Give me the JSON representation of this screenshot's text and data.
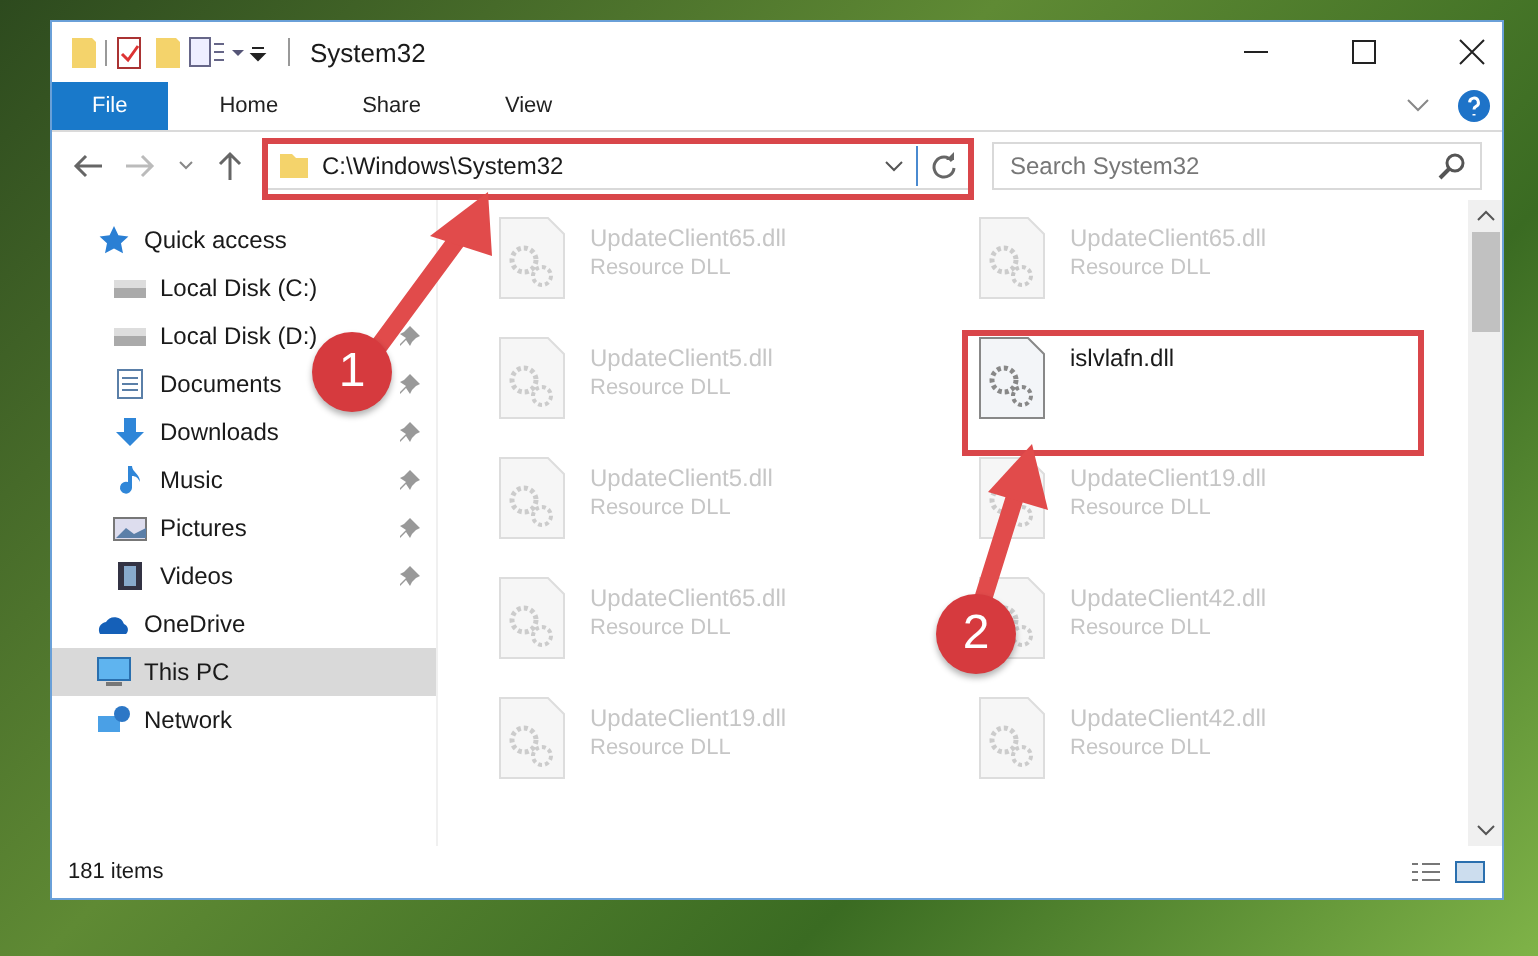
{
  "window": {
    "title": "System32"
  },
  "ribbon_tabs": [
    {
      "label": "File",
      "selected": true
    },
    {
      "label": "Home",
      "selected": false
    },
    {
      "label": "Share",
      "selected": false
    },
    {
      "label": "View",
      "selected": false
    }
  ],
  "address": {
    "path": "C:\\Windows\\System32"
  },
  "search": {
    "placeholder": "Search System32"
  },
  "sidebar": {
    "items": [
      {
        "label": "Quick access",
        "kind": "star",
        "selected": false,
        "children": [
          {
            "label": "Local Disk (C:)",
            "kind": "drive",
            "pinned": false,
            "selected": false
          },
          {
            "label": "Local Disk (D:)",
            "kind": "drive",
            "pinned": true,
            "selected": false
          },
          {
            "label": "Documents",
            "kind": "document",
            "pinned": true,
            "selected": false
          },
          {
            "label": "Downloads",
            "kind": "download",
            "pinned": true,
            "selected": false
          },
          {
            "label": "Music",
            "kind": "music",
            "pinned": true,
            "selected": false
          },
          {
            "label": "Pictures",
            "kind": "picture",
            "pinned": true,
            "selected": false
          },
          {
            "label": "Videos",
            "kind": "video",
            "pinned": true,
            "selected": false
          }
        ]
      },
      {
        "label": "OneDrive",
        "kind": "cloud",
        "selected": false
      },
      {
        "label": "This PC",
        "kind": "pc",
        "selected": true
      },
      {
        "label": "Network",
        "kind": "network",
        "selected": false
      }
    ]
  },
  "files": [
    {
      "name": "UpdateClient65.dll",
      "type": "Resource DLL",
      "faded": true
    },
    {
      "name": "UpdateClient65.dll",
      "type": "Resource DLL",
      "faded": true
    },
    {
      "name": "UpdateClient5.dll",
      "type": "Resource DLL",
      "faded": true
    },
    {
      "name": "islvlafn.dll",
      "faded": false
    },
    {
      "name": "UpdateClient5.dll",
      "type": "Resource DLL",
      "faded": true
    },
    {
      "name": "UpdateClient19.dll",
      "type": "Resource DLL",
      "faded": true
    },
    {
      "name": "UpdateClient65.dll",
      "type": "Resource DLL",
      "faded": true
    },
    {
      "name": "UpdateClient42.dll",
      "type": "Resource DLL",
      "faded": true
    },
    {
      "name": "UpdateClient19.dll",
      "type": "Resource DLL",
      "faded": true
    },
    {
      "name": "UpdateClient42.dll",
      "type": "Resource DLL",
      "faded": true
    }
  ],
  "status_bar": {
    "count": "181 items"
  },
  "annotations": [
    {
      "number": "1"
    },
    {
      "number": "2"
    }
  ]
}
